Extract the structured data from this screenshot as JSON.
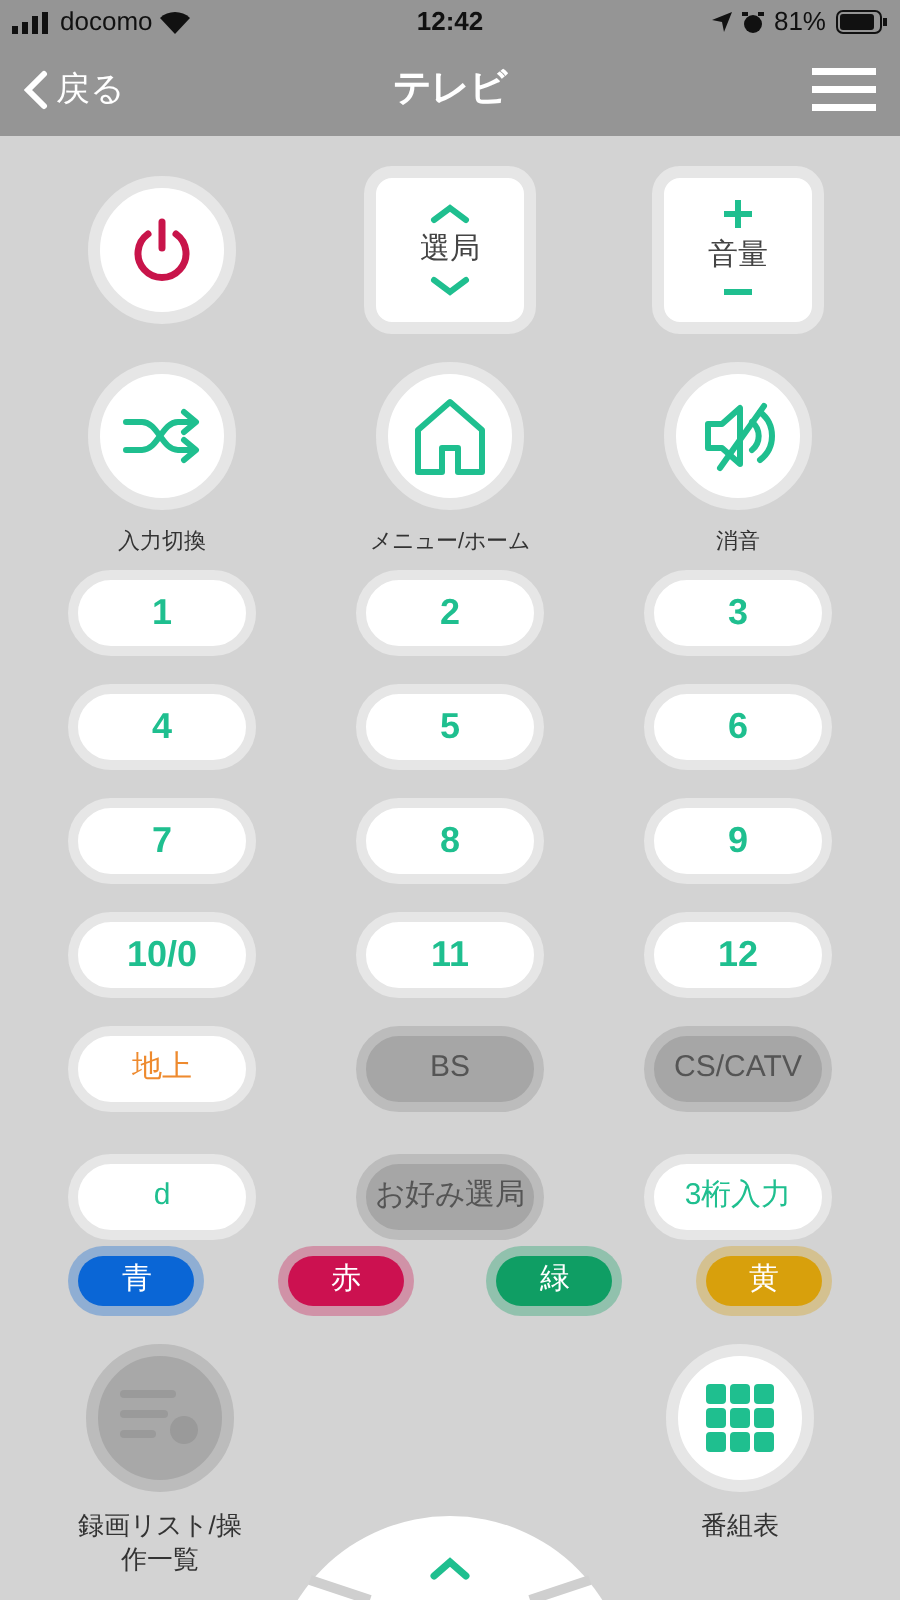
{
  "status_bar": {
    "carrier": "docomo",
    "time": "12:42",
    "battery": "81%"
  },
  "nav": {
    "back": "戻る",
    "title": "テレビ"
  },
  "top_buttons": [
    {
      "kind": "power"
    },
    {
      "kind": "channel",
      "label": "選局"
    },
    {
      "kind": "volume",
      "label": "音量"
    }
  ],
  "icon_buttons": [
    {
      "kind": "input",
      "label": "入力切換"
    },
    {
      "kind": "home",
      "label": "メニュー/ホーム"
    },
    {
      "kind": "mute",
      "label": "消音"
    }
  ],
  "number_buttons": [
    "1",
    "2",
    "3",
    "4",
    "5",
    "6",
    "7",
    "8",
    "9",
    "10/0",
    "11",
    "12"
  ],
  "mode_buttons": [
    {
      "label": "地上",
      "disabled": false,
      "color": "#ee8a2e"
    },
    {
      "label": "BS",
      "disabled": true
    },
    {
      "label": "CS/CATV",
      "disabled": true
    },
    {
      "label": "d",
      "disabled": false,
      "color": "#1fbf8f"
    },
    {
      "label": "お好み選局",
      "disabled": true
    },
    {
      "label": "3桁入力",
      "disabled": false,
      "color": "#1fbf8f"
    }
  ],
  "color_buttons": [
    {
      "label": "青",
      "color": "#0a66d6"
    },
    {
      "label": "赤",
      "color": "#cc1150"
    },
    {
      "label": "緑",
      "color": "#0f9e64"
    },
    {
      "label": "黄",
      "color": "#d8a00c"
    }
  ],
  "bottom_buttons": [
    {
      "kind": "recordings",
      "label": "録画リスト/操作一覧",
      "disabled": true
    },
    {
      "kind": "guide",
      "label": "番組表",
      "disabled": false
    }
  ]
}
